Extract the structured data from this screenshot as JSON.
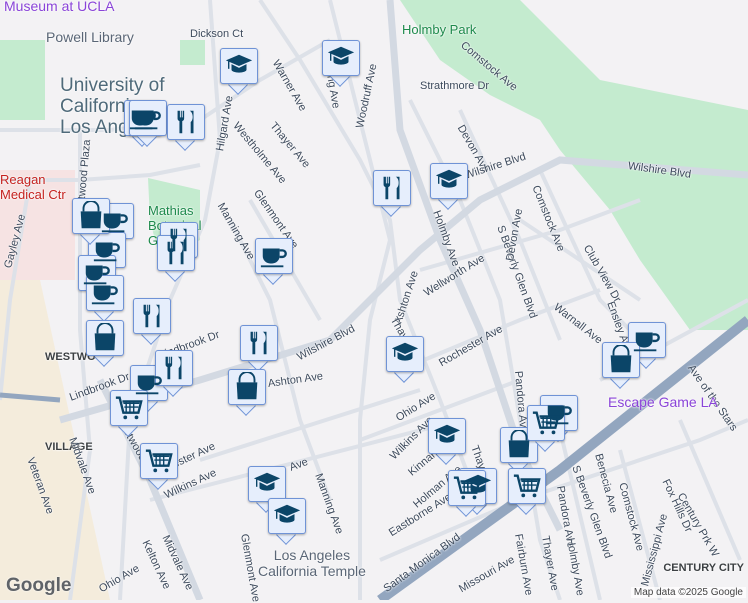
{
  "map": {
    "labels": [
      "Museum at UCLA",
      "Powell Library",
      "Dickson Ct",
      "University of\nCalifornia\nLos Angeles",
      "Holmby Park",
      "Comstock Ave",
      "Strathmore Dr",
      "Devon Ave",
      "Wilshire Blvd",
      "Wilshire Blvd",
      "Wilshire Blvd",
      "Warner Ave",
      "Thayer Ave",
      "Westholme Ave",
      "Hilgard Ave",
      "Woodruff Ave",
      "Glenmont Ave",
      "Manning Ave",
      "Mathias Botanical Garden",
      "Reagan Medical Ctr",
      "Gayley Ave",
      "Westwood Plaza",
      "Ashton Ave",
      "Ashton Ave",
      "Holmby Ave",
      "S Beverly Glen Blvd",
      "Devon Ave",
      "Comstock Ave",
      "Club View Dr",
      "Wellworth Ave",
      "Warnall Ave",
      "Ensley Ave",
      "Thayer Ave",
      "Rochester Ave",
      "Ave of the Stars",
      "Escape Game LA",
      "Ohio Ave",
      "Wilkins Ave",
      "Kinnard Ave",
      "Holman Ave",
      "Thayer Ave",
      "Eastborne Ave",
      "Santa Monica Blvd",
      "Pandora Ave",
      "Pandora Ave",
      "S Beverly Glen Blvd",
      "Benecia Ave",
      "Comstock Ave",
      "Fox Hills Dr",
      "Mississippi Ave",
      "Century Prk W",
      "CENTURY CITY",
      "Holmby Ave",
      "Fairburn Ave",
      "Thayer Ave",
      "Missouri Ave",
      "Los Angeles\nCalifornia Temple",
      "Manning Ave",
      "Lindbrook Dr",
      "Lindbrook Dr",
      "WESTWOOD VILLAGE",
      "Midvale Ave",
      "Midvale Ave",
      "Veteran Ave",
      "Westwood Blvd",
      "Wilkins Ave",
      "Rochester Ave",
      "Ohio Ave",
      "Kelton Ave",
      "Ave",
      "Glenmont Ave",
      "Manning Ave"
    ],
    "markers": [
      "school",
      "school",
      "school",
      "school",
      "school",
      "school",
      "school",
      "school",
      "cafe",
      "cafe",
      "cafe",
      "cafe",
      "cafe",
      "cafe",
      "cafe",
      "cafe",
      "cafe",
      "cafe",
      "restaurant",
      "restaurant",
      "restaurant",
      "restaurant",
      "restaurant",
      "restaurant",
      "restaurant",
      "shopping",
      "shopping",
      "shopping",
      "shopping",
      "shopping",
      "grocery",
      "grocery",
      "grocery",
      "grocery",
      "grocery"
    ],
    "attribution": "Map data ©2025 Google",
    "logo": "Google"
  },
  "colors": {
    "marker_icon": "#0b4568",
    "park": "#c4ebcf",
    "highway": "#93a6bf",
    "campus": "#f0e6e6"
  }
}
